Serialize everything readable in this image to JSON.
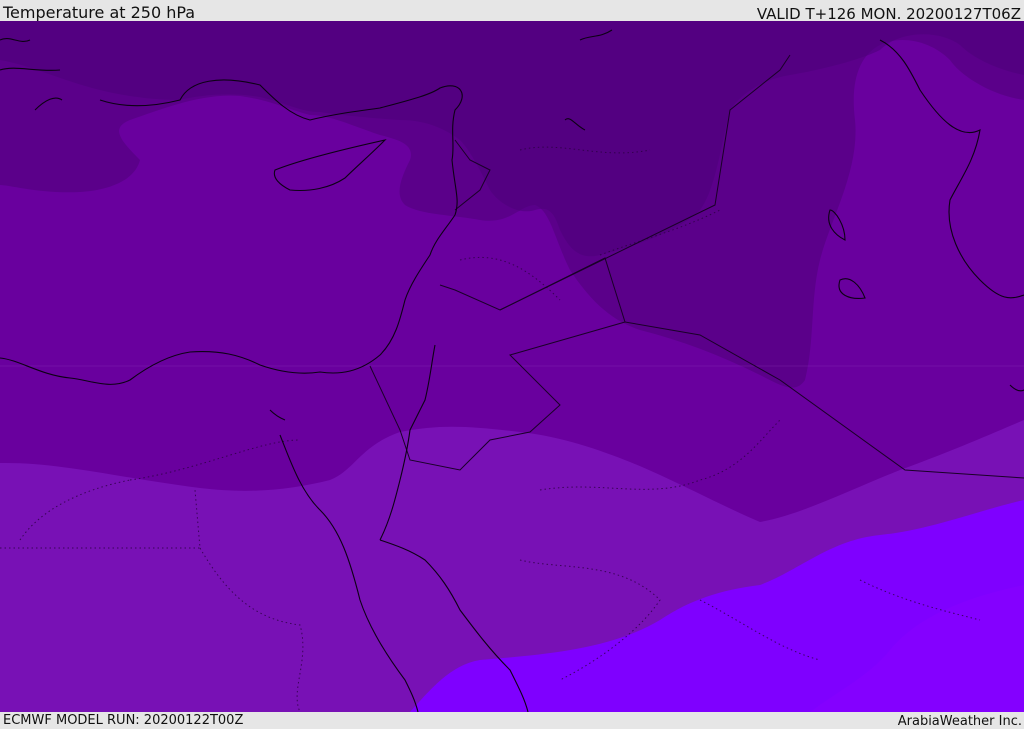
{
  "header": {
    "title": "Temperature at 250 hPa",
    "valid": "VALID T+126 MON. 20200127T06Z"
  },
  "footer": {
    "model_run": "ECMWF MODEL RUN: 20200122T00Z",
    "credit": "ArabiaWeather Inc."
  },
  "legend_colors": {
    "coldest": "#4d007a",
    "cold": "#5b008a",
    "cool": "#69009e",
    "mild": "#7811b5",
    "warmer": "#7f00ff"
  }
}
